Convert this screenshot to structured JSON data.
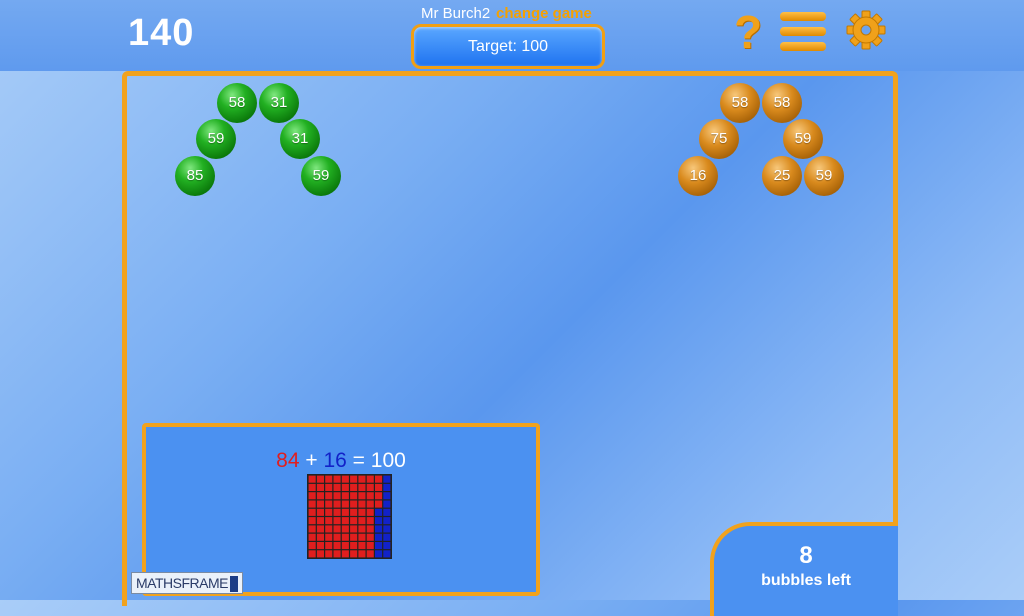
{
  "header": {
    "score": "140",
    "player_name": "Mr Burch2",
    "change_game_label": "change game",
    "target_label": "Target: 100",
    "help_glyph": "?"
  },
  "icons": {
    "help": "question-mark-icon",
    "menu": "hamburger-menu-icon",
    "settings": "gear-icon"
  },
  "colors": {
    "accent": "#f1a21d",
    "green_bubble": "#1a9a1a",
    "orange_bubble": "#c77a12",
    "addend_a": "#e01e1e",
    "addend_b": "#1222c8"
  },
  "green_bubbles": [
    "58",
    "31",
    "59",
    "31",
    "85",
    "59"
  ],
  "orange_bubbles": [
    "58",
    "58",
    "75",
    "59",
    "16",
    "25",
    "59"
  ],
  "sum_panel": {
    "addend_a": "84",
    "plus": "+",
    "addend_b": "16",
    "equals": "=",
    "total": "100",
    "grid_red_count": 84,
    "grid_blue_count": 16
  },
  "logo": "MATHSFRAME",
  "bubbles_left": {
    "count": "8",
    "label": "bubbles left"
  }
}
